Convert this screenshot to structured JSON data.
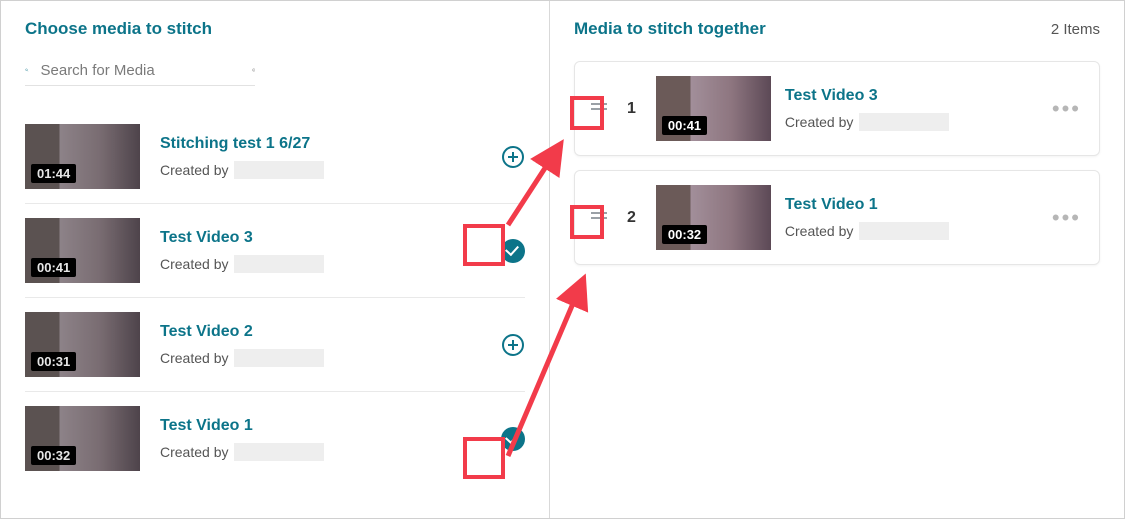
{
  "left": {
    "title": "Choose media to stitch",
    "search_placeholder": "Search for Media",
    "items": [
      {
        "title": "Stitching test 1 6/27",
        "duration": "01:44",
        "created_label": "Created by",
        "selected": false
      },
      {
        "title": "Test Video 3",
        "duration": "00:41",
        "created_label": "Created by",
        "selected": true
      },
      {
        "title": "Test Video 2",
        "duration": "00:31",
        "created_label": "Created by",
        "selected": false
      },
      {
        "title": "Test Video 1",
        "duration": "00:32",
        "created_label": "Created by",
        "selected": true
      }
    ]
  },
  "right": {
    "title": "Media to stitch together",
    "count_label": "2 Items",
    "items": [
      {
        "order": "1",
        "title": "Test Video 3",
        "duration": "00:41",
        "created_label": "Created by"
      },
      {
        "order": "2",
        "title": "Test Video 1",
        "duration": "00:32",
        "created_label": "Created by"
      }
    ]
  }
}
